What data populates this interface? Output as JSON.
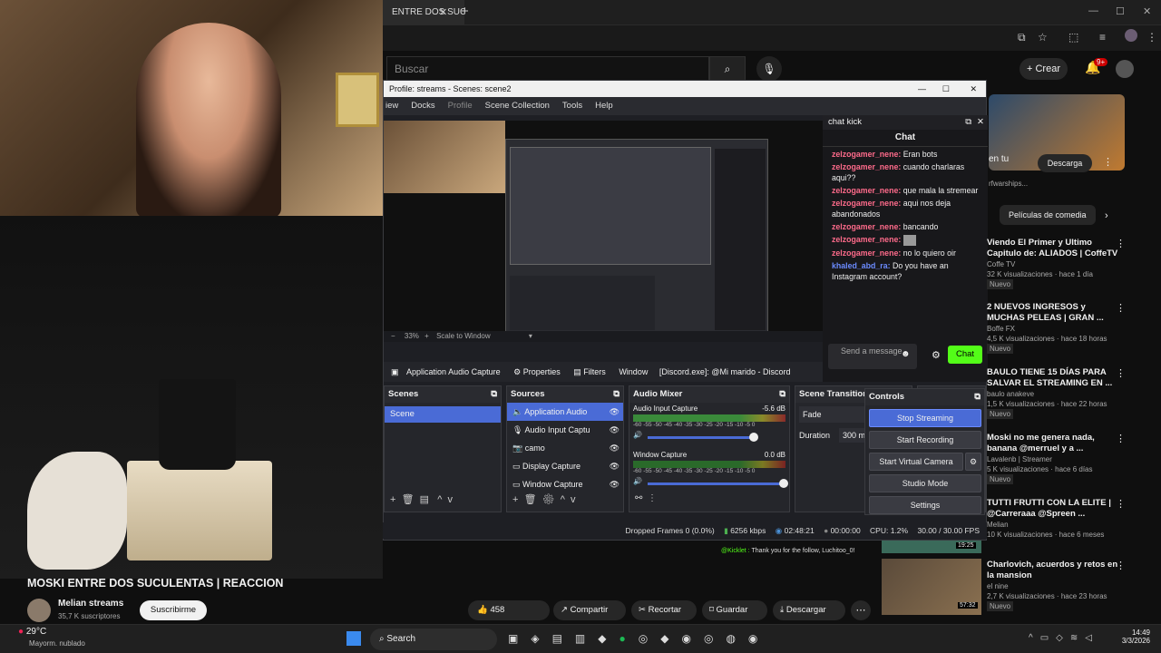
{
  "browser": {
    "tab_title": "ENTRE DOS SUCUL",
    "search_placeholder": "Buscar",
    "create_label": "Crear",
    "notif_count": "9+"
  },
  "obs": {
    "title": "Profile: streams - Scenes: scene2",
    "menu": [
      "iew",
      "Docks",
      "Profile",
      "Scene Collection",
      "Tools",
      "Help"
    ],
    "zoom": "33%",
    "scale_mode": "Scale to Window",
    "source_bar": {
      "source": "Application Audio Capture",
      "properties": "Properties",
      "filters": "Filters",
      "window_label": "Window",
      "window_value": "[Discord.exe]: @Mi marido - Discord"
    },
    "scenes": {
      "header": "Scenes",
      "items": [
        "Scene"
      ]
    },
    "sources": {
      "header": "Sources",
      "items": [
        "Application Audio",
        "Audio Input Captu",
        "camo",
        "Display Capture",
        "Window Capture"
      ]
    },
    "mixer": {
      "header": "Audio Mixer",
      "ch1": "Audio Input Capture",
      "ch1_db": "-5.6 dB",
      "ch2": "Window Capture",
      "ch2_db": "0.0 dB",
      "scale": "-60 -55 -50 -45 -40 -35 -30 -25 -20 -15 -10 -5 0",
      "ch1_vol": 0.78,
      "ch2_vol": 1.0
    },
    "transitions": {
      "header": "Scene Transitions",
      "type": "Fade",
      "duration_label": "Duration",
      "duration": "300 ms"
    },
    "controls": {
      "header": "Controls",
      "stop": "Stop Streaming",
      "record": "Start Recording",
      "virtual": "Start Virtual Camera",
      "studio": "Studio Mode",
      "settings": "Settings"
    },
    "status": {
      "dropped": "Dropped Frames 0 (0.0%)",
      "kbps": "6256 kbps",
      "live": "02:48:21",
      "rec": "00:00:00",
      "cpu": "CPU: 1.2%",
      "fps": "30.00 / 30.00 FPS"
    }
  },
  "chat": {
    "window_title": "chat kick",
    "header": "Chat",
    "messages": [
      {
        "user": "zelzogamer_nene:",
        "text": "Eran bots"
      },
      {
        "user": "zelzogamer_nene:",
        "text": "cuando charlaras aqui??"
      },
      {
        "user": "zelzogamer_nene:",
        "text": "que mala la stremear"
      },
      {
        "user": "zelzogamer_nene:",
        "text": "aqui nos deja abandonados"
      },
      {
        "user": "zelzogamer_nene:",
        "text": "bancando"
      },
      {
        "user": "zelzogamer_nene:",
        "text": ""
      },
      {
        "user": "zelzogamer_nene:",
        "text": "no lo quiero oir"
      },
      {
        "user": "khaled_abd_ra:",
        "text": "Do you have an Instagram account?"
      }
    ],
    "send_placeholder": "Send a message",
    "send_label": "Chat"
  },
  "video": {
    "title": "MOSKI ENTRE DOS SUCULENTAS | REACCION",
    "channel": "Melian streams",
    "subs": "35,7 K suscriptores",
    "subscribe": "Suscribirme",
    "likes": "458",
    "share": "Compartir",
    "clip": "Recortar",
    "save": "Guardar",
    "download": "Descargar"
  },
  "sidebar": {
    "download_btn": "Descarga",
    "ad_text": "en tu",
    "ad_sub": "rfwarships...",
    "chip": "Películas de comedia",
    "items": [
      {
        "title": "Viendo El Primer y Ultimo Capitulo de: ALIADOS | CoffeTV",
        "channel": "Coffe TV",
        "meta": "32 K visualizaciones · hace 1 día",
        "badge": "Nuevo"
      },
      {
        "title": "2 NUEVOS INGRESOS y MUCHAS PELEAS | GRAN ...",
        "channel": "Boffe FX",
        "meta": "4,5 K visualizaciones · hace 18 horas",
        "badge": "Nuevo"
      },
      {
        "title": "BAULO TIENE 15 DÍAS PARA SALVAR EL STREAMING EN ...",
        "channel": "baulo anakeve",
        "meta": "1,5 K visualizaciones · hace 22 horas",
        "badge": "Nuevo"
      },
      {
        "title": "Moski no me genera nada, banana @merruel y a ...",
        "channel": "Lavalenb | Streamer",
        "meta": "5 K visualizaciones · hace 6 días",
        "badge": "Nuevo"
      },
      {
        "title": "TUTTI FRUTTI CON LA ELITE | @Carreraaa @Spreen ...",
        "channel": "Melian",
        "meta": "10 K visualizaciones · hace 6 meses",
        "badge": ""
      },
      {
        "title": "Charlovich, acuerdos y retos en la mansion",
        "channel": "el nine",
        "meta": "2,7 K visualizaciones · hace 23 horas",
        "badge": "Nuevo"
      }
    ],
    "thumb_time1": "19:25",
    "thumb_time2": "57:32"
  },
  "overlay_chat": {
    "user": "@Kicklet :",
    "text": "Thank you for the follow, Luchitoo_0!"
  },
  "taskbar": {
    "weather": "29°C",
    "weather_desc": "Mayorm. nublado",
    "search": "Search",
    "time": "14:49",
    "date": "3/3/2026"
  },
  "colors": {
    "accent": "#4a6bd6",
    "kick_green": "#53fc18",
    "yt_red": "#ff0000"
  }
}
